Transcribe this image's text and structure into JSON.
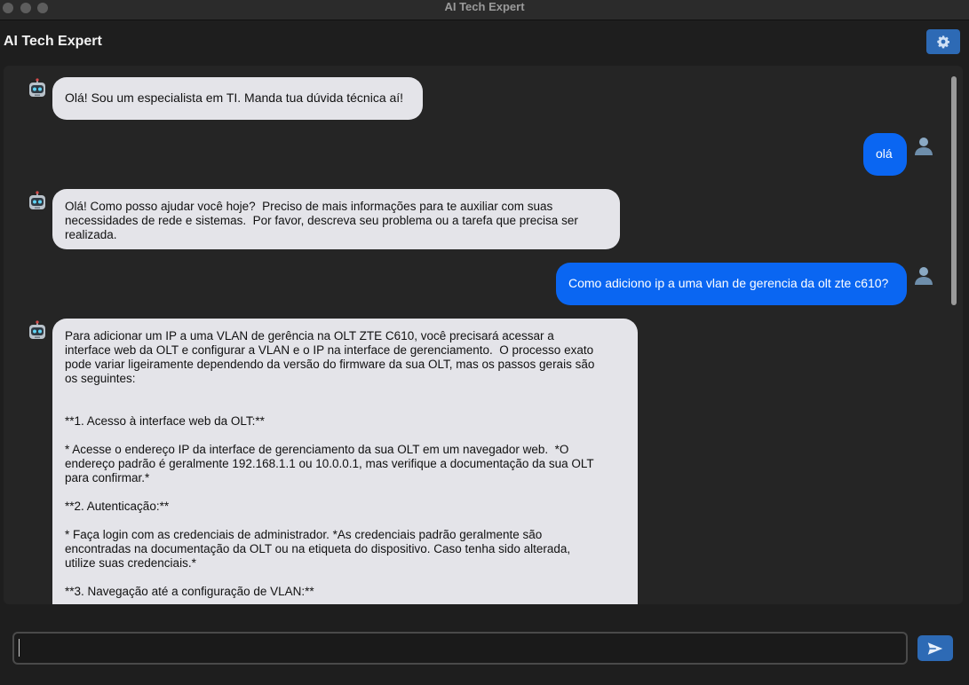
{
  "window": {
    "title": "AI Tech Expert"
  },
  "header": {
    "app_title": "AI Tech Expert",
    "settings_icon": "gear-icon"
  },
  "colors": {
    "accent": "#2d6ab5",
    "user_bubble": "#0a66f2",
    "bot_bubble": "#e4e4e9",
    "background": "#1e1e1e",
    "chat_panel": "#252525"
  },
  "messages": [
    {
      "role": "bot",
      "avatar_icon": "robot-icon",
      "text": "Olá! Sou um especialista em TI. Manda tua dúvida técnica aí!"
    },
    {
      "role": "user",
      "avatar_icon": "user-icon",
      "text": "olá"
    },
    {
      "role": "bot",
      "avatar_icon": "robot-icon",
      "text": "Olá! Como posso ajudar você hoje?  Preciso de mais informações para te auxiliar com suas\nnecessidades de rede e sistemas.  Por favor, descreva seu problema ou a tarefa que precisa ser\nrealizada."
    },
    {
      "role": "user",
      "avatar_icon": "user-icon",
      "text": "Como adiciono ip a uma vlan de gerencia da olt zte c610?"
    },
    {
      "role": "bot",
      "avatar_icon": "robot-icon",
      "text": "Para adicionar um IP a uma VLAN de gerência na OLT ZTE C610, você precisará acessar a\ninterface web da OLT e configurar a VLAN e o IP na interface de gerenciamento.  O processo exato\npode variar ligeiramente dependendo da versão do firmware da sua OLT, mas os passos gerais são\nos seguintes:\n\n\n**1. Acesso à interface web da OLT:**\n\n* Acesse o endereço IP da interface de gerenciamento da sua OLT em um navegador web.  *O\nendereço padrão é geralmente 192.168.1.1 ou 10.0.0.1, mas verifique a documentação da sua OLT\npara confirmar.*\n\n**2. Autenticação:**\n\n* Faça login com as credenciais de administrador. *As credenciais padrão geralmente são\nencontradas na documentação da OLT ou na etiqueta do dispositivo. Caso tenha sido alterada,\nutilize suas credenciais.*\n\n**3. Navegação até a configuração de VLAN:**"
    }
  ],
  "composer": {
    "value": "",
    "placeholder": "",
    "send_icon": "send-icon"
  }
}
